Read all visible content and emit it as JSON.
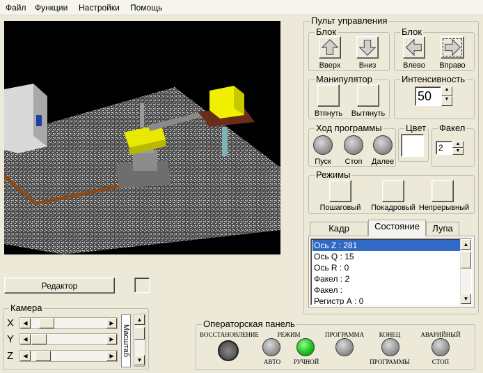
{
  "menu": {
    "items": [
      "Файл",
      "Функции",
      "Настройки",
      "Помощь"
    ]
  },
  "control_panel": {
    "title": "Пульт управления",
    "block_vertical": {
      "title": "Блок",
      "up": "Вверх",
      "down": "Вниз"
    },
    "block_horizontal": {
      "title": "Блок",
      "left": "Влево",
      "right": "Вправо"
    },
    "manipulator": {
      "title": "Манипулятор",
      "pull_in": "Втянуть",
      "push_out": "Вытянуть"
    },
    "intensity": {
      "title": "Интенсивность",
      "value": "50"
    },
    "program_flow": {
      "title": "Ход программы",
      "start": "Пуск",
      "stop": "Стоп",
      "next": "Далее"
    },
    "color": {
      "title": "Цвет",
      "value": "#ffffff"
    },
    "torch": {
      "title": "Факел",
      "value": "2"
    },
    "modes": {
      "title": "Режимы",
      "step": "Пошаговый",
      "frame": "Покадровый",
      "continuous": "Непрерывный"
    },
    "tabs": [
      "Кадр",
      "Состояние",
      "Лупа"
    ],
    "active_tab": "Состояние",
    "status_list": [
      "Ось Z : 281",
      "Ось Q : 15",
      "Ось R : 0",
      "Факел : 2",
      "Факел :",
      "Регистр А : 0"
    ]
  },
  "editor": {
    "label": "Редактор"
  },
  "camera": {
    "title": "Камера",
    "axes": [
      "X",
      "Y",
      "Z"
    ],
    "scale_label": "Масштаб"
  },
  "operator_panel": {
    "title": "Операторская панель",
    "restore": "ВОССТАНОВЛЕНИЕ",
    "mode": "РЕЖИМ",
    "auto": "АВТО",
    "manual": "РУЧНОЙ",
    "program": "ПРОГРАММА",
    "end": "КОНЕЦ",
    "end2": "ПРОГРАММЫ",
    "emergency": "АВАРИЙНЫЙ",
    "stop": "СТОП"
  },
  "colors": {
    "active_lamp": "#1fbf1f",
    "selection": "#316ac5"
  }
}
